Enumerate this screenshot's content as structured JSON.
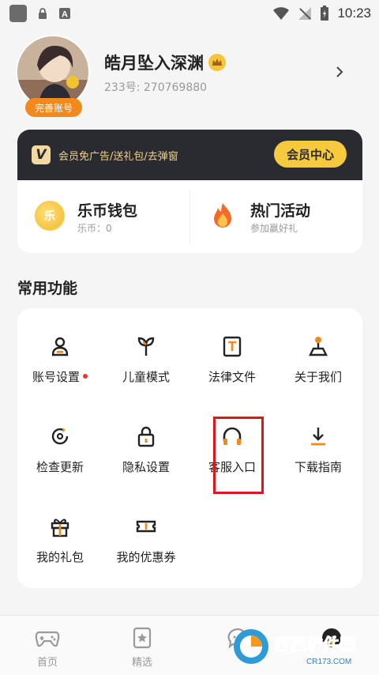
{
  "status_bar": {
    "time": "10:23"
  },
  "profile": {
    "username": "皓月坠入深渊",
    "id_text": "233号: 270769880",
    "complete_badge": "完善账号"
  },
  "member": {
    "desc": "会员免广告/送礼包/去弹窗",
    "button": "会员中心",
    "logo_letter": "V"
  },
  "cards": [
    {
      "title": "乐币钱包",
      "sub": "乐币：0",
      "icon": "coin-icon",
      "coin_char": "乐"
    },
    {
      "title": "热门活动",
      "sub": "参加赢好礼",
      "icon": "fire-icon"
    }
  ],
  "section_title": "常用功能",
  "functions": [
    {
      "label": "账号设置",
      "icon": "user-icon",
      "dot": true
    },
    {
      "label": "儿童模式",
      "icon": "sprout-icon"
    },
    {
      "label": "法律文件",
      "icon": "document-icon"
    },
    {
      "label": "关于我们",
      "icon": "joystick-icon"
    },
    {
      "label": "检查更新",
      "icon": "refresh-icon"
    },
    {
      "label": "隐私设置",
      "icon": "lock-icon"
    },
    {
      "label": "客服入口",
      "icon": "headset-icon"
    },
    {
      "label": "下载指南",
      "icon": "download-icon"
    },
    {
      "label": "我的礼包",
      "icon": "gift-icon"
    },
    {
      "label": "我的优惠券",
      "icon": "coupon-icon"
    }
  ],
  "tabs": [
    {
      "label": "首页",
      "icon": "gamepad-icon"
    },
    {
      "label": "精选",
      "icon": "star-card-icon"
    },
    {
      "label": "",
      "icon": "chat-icon"
    },
    {
      "label": "",
      "icon": "face-icon"
    }
  ],
  "watermark": {
    "text": "西西软件园",
    "sub": "CR173.COM"
  },
  "colors": {
    "accent": "#f08a1c",
    "member_bg": "#2a2a31",
    "gold": "#f7c93d",
    "highlight": "#e0151b"
  }
}
